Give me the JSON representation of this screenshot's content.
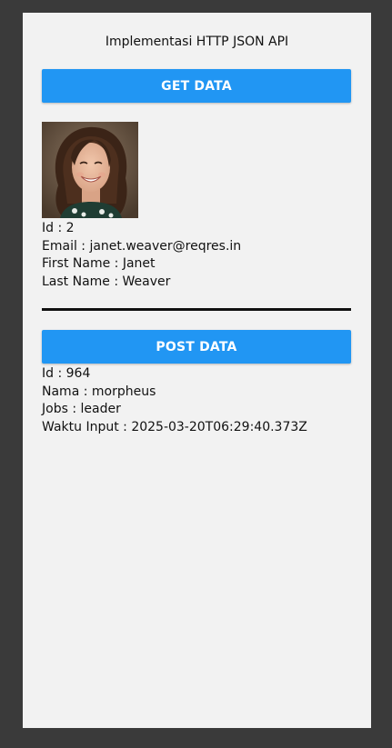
{
  "app": {
    "title": "Implementasi HTTP JSON API"
  },
  "get_section": {
    "button_label": "GET DATA",
    "avatar_icon": "user-photo-woman-smiling",
    "user": {
      "id_line": "Id : 2",
      "email_line": "Email : janet.weaver@reqres.in",
      "first_name_line": "First Name : Janet",
      "last_name_line": "Last Name : Weaver"
    }
  },
  "post_section": {
    "button_label": "POST DATA",
    "result": {
      "id_line": "Id : 964",
      "nama_line": "Nama : morpheus",
      "jobs_line": "Jobs : leader",
      "waktu_line": "Waktu Input : 2025-03-20T06:29:40.373Z"
    }
  },
  "colors": {
    "window_bg": "#3a3a3a",
    "app_bg": "#f2f2f2",
    "button_bg": "#2196f3",
    "button_text": "#ffffff",
    "text": "#111111"
  }
}
